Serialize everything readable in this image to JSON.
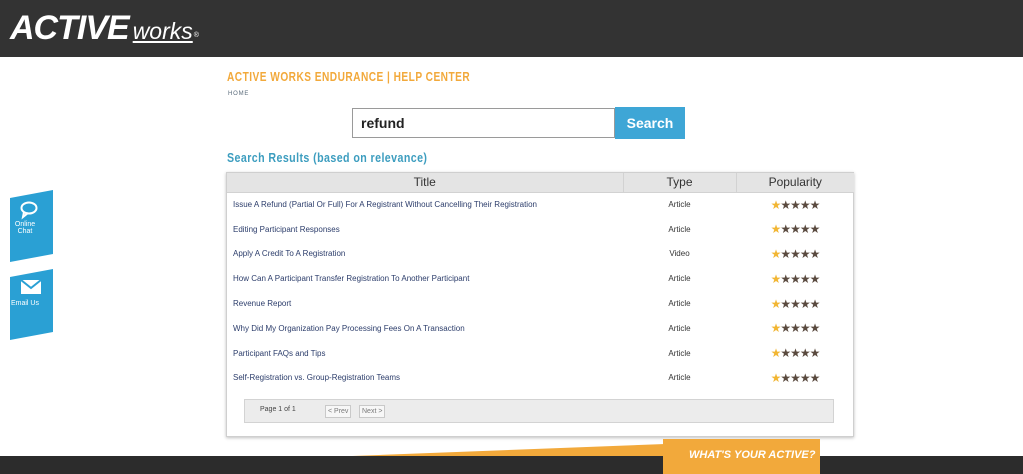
{
  "brand": {
    "logo_main": "ACTIVE",
    "logo_sub": "works",
    "logo_dot": "®"
  },
  "header": {
    "site_title": "ACTIVE WORKS ENDURANCE | HELP CENTER",
    "breadcrumb": "HOME"
  },
  "search": {
    "value": "refund",
    "button_label": "Search"
  },
  "results": {
    "heading": "Search Results (based on relevance)",
    "columns": [
      "Title",
      "Type",
      "Popularity"
    ],
    "rows": [
      {
        "title": "Issue A Refund (Partial Or Full) For A Registrant Without Cancelling Their Registration",
        "type": "Article"
      },
      {
        "title": "Editing Participant Responses",
        "type": "Article"
      },
      {
        "title": "Apply A Credit To A Registration",
        "type": "Video"
      },
      {
        "title": "How Can A Participant Transfer Registration To Another Participant",
        "type": "Article"
      },
      {
        "title": "Revenue Report",
        "type": "Article"
      },
      {
        "title": "Why Did My Organization Pay Processing Fees On A Transaction",
        "type": "Article"
      },
      {
        "title": "Participant FAQs and Tips",
        "type": "Article"
      },
      {
        "title": "Self-Registration vs. Group-Registration Teams",
        "type": "Article"
      }
    ],
    "popularity_stars": 5
  },
  "pager": {
    "info": "Page 1 of 1",
    "prev_label": "< Prev",
    "next_label": "Next >"
  },
  "side_tabs": {
    "chat_label": "Online Chat",
    "email_label": "Email Us"
  },
  "footer": {
    "tagline": "WHAT'S YOUR ACTIVE?"
  },
  "colors": {
    "accent_orange": "#f2a93b",
    "accent_blue": "#3ea6d6",
    "topbar": "#333333"
  },
  "icons": {
    "chat": "chat-bubble-icon",
    "email": "envelope-icon",
    "star": "star-icon"
  }
}
